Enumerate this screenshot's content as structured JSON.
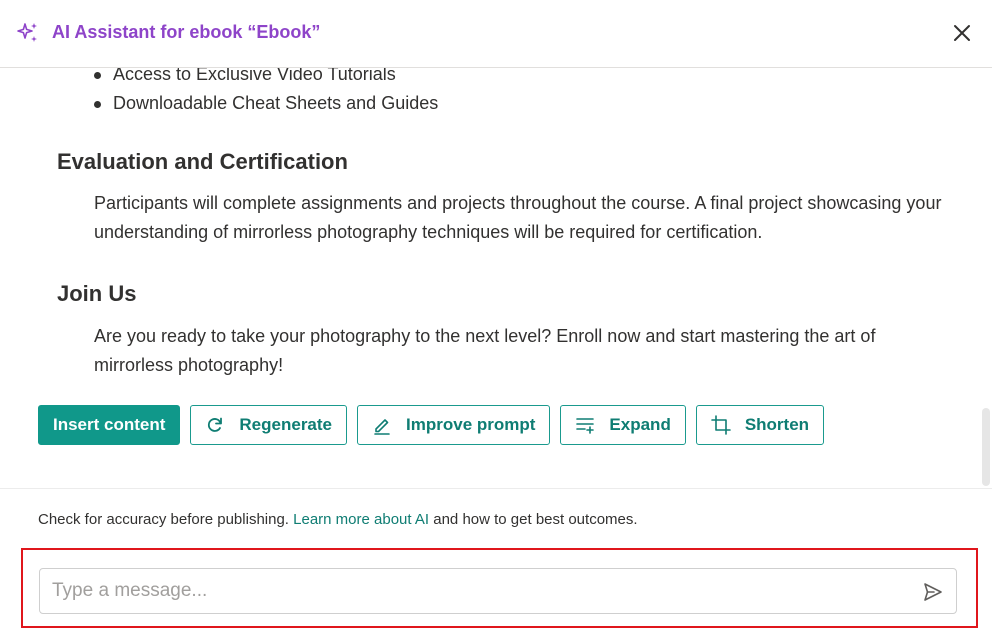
{
  "header": {
    "title": "AI Assistant for ebook “Ebook”",
    "accent_color": "#8e44c9",
    "icon": "sparkle-icon",
    "close_icon": "close-icon"
  },
  "content": {
    "bullets": [
      "Access to Exclusive Video Tutorials",
      "Downloadable Cheat Sheets and Guides"
    ],
    "sections": [
      {
        "heading": "Evaluation and Certification",
        "body": "Participants will complete assignments and projects throughout the course. A final project showcasing your understanding of mirrorless photography techniques will be required for certification."
      },
      {
        "heading": "Join Us",
        "body": "Are you ready to take your photography to the next level? Enroll now and start mastering the art of mirrorless photography!"
      }
    ]
  },
  "actions": {
    "insert": "Insert content",
    "regenerate": "Regenerate",
    "improve": "Improve prompt",
    "expand": "Expand",
    "shorten": "Shorten",
    "primary_color": "#10988a"
  },
  "footer": {
    "disclaimer_pre": "Check for accuracy before publishing. ",
    "disclaimer_link": "Learn more about AI",
    "disclaimer_post": " and how to get best outcomes.",
    "input_placeholder": "Type a message...",
    "send_icon": "send-icon",
    "highlight_color": "#e0161c"
  }
}
